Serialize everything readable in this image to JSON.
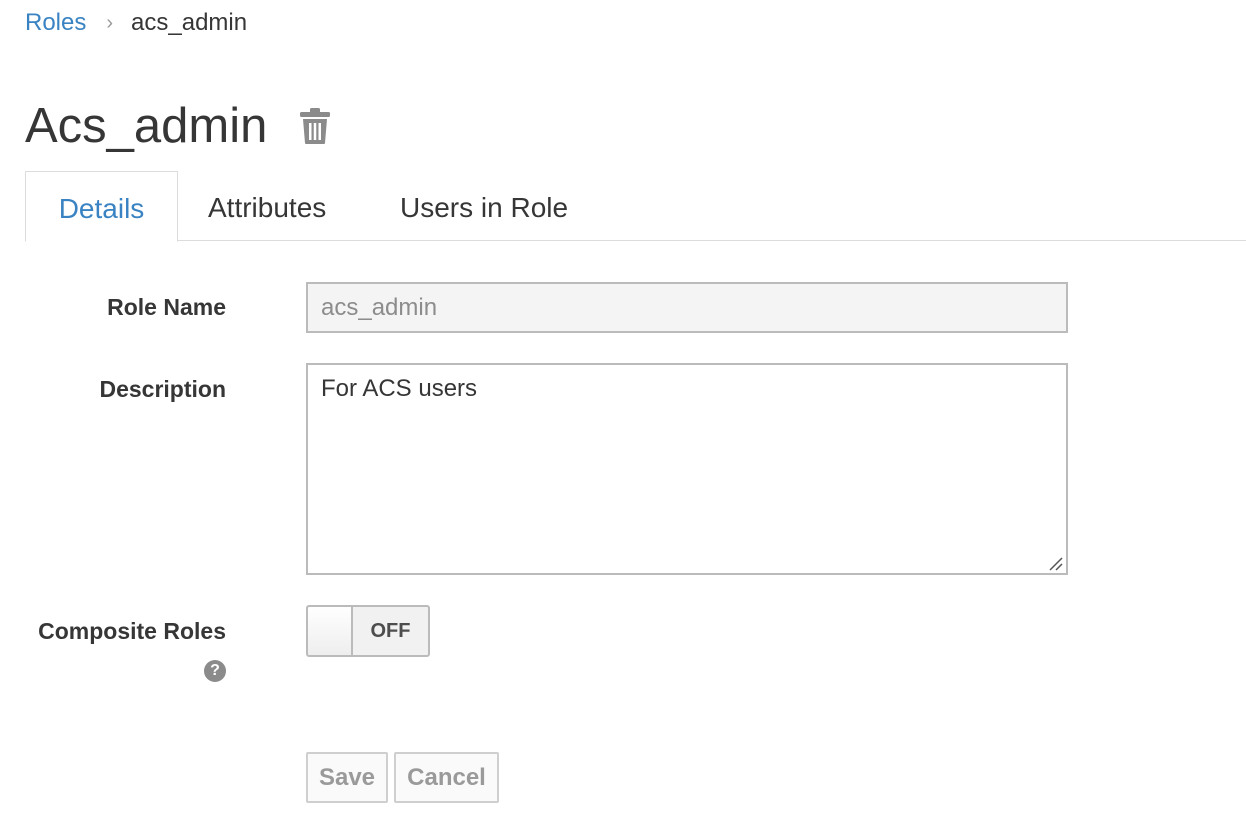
{
  "breadcrumb": {
    "parent": "Roles",
    "separator": "›",
    "current": "acs_admin"
  },
  "header": {
    "title": "Acs_admin",
    "delete_icon": "trash-icon"
  },
  "tabs": [
    {
      "label": "Details",
      "active": true
    },
    {
      "label": "Attributes",
      "active": false
    },
    {
      "label": "Users in Role",
      "active": false
    }
  ],
  "form": {
    "role_name": {
      "label": "Role Name",
      "value": "acs_admin",
      "readonly": true
    },
    "description": {
      "label": "Description",
      "value": "For ACS users"
    },
    "composite_roles": {
      "label": "Composite Roles",
      "state": "OFF",
      "help_icon": "question-circle-icon"
    }
  },
  "actions": {
    "save_label": "Save",
    "cancel_label": "Cancel"
  },
  "colors": {
    "link": "#3a83c3",
    "text": "#363636",
    "readonly_bg": "#f4f4f4",
    "border": "#bbbbbb"
  }
}
